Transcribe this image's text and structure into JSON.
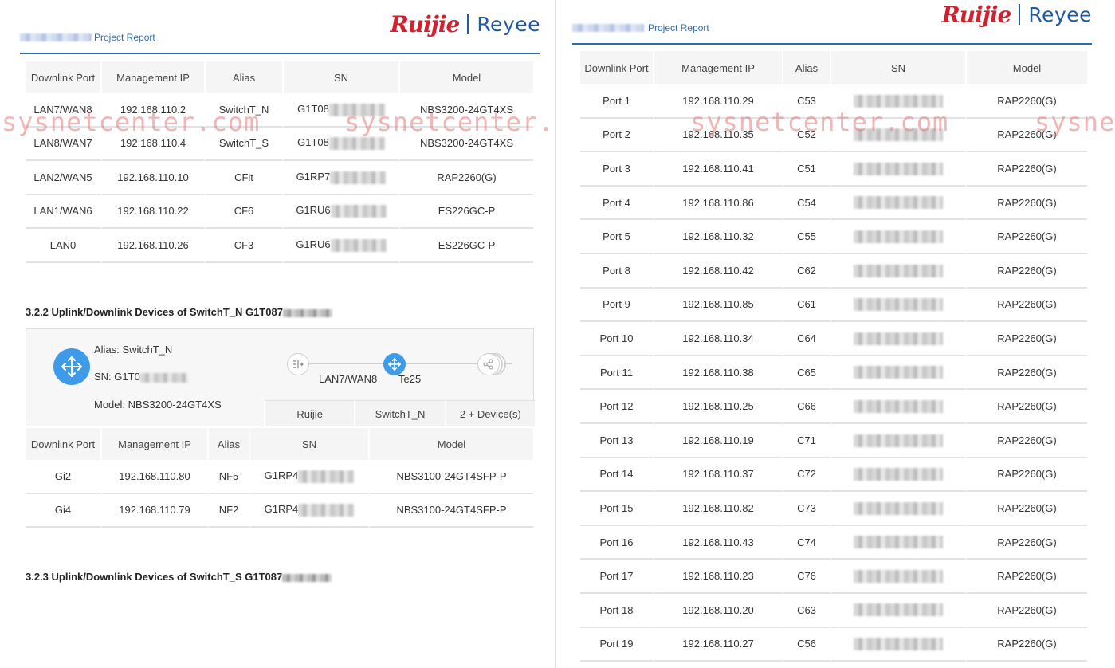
{
  "report_title": "Project Report",
  "logo": {
    "ruijie": "Ruijie",
    "reyee": "Reyee"
  },
  "watermark": "sysnetcenter.com",
  "watermark_partial": "sysne",
  "columns_main": [
    "Downlink Port",
    "Management IP",
    "Alias",
    "SN",
    "Model"
  ],
  "left_table": [
    {
      "port": "LAN7/WAN8",
      "ip": "192.168.110.2",
      "alias": "SwitchT_N",
      "sn": "G1T08",
      "model": "NBS3200-24GT4XS"
    },
    {
      "port": "LAN8/WAN7",
      "ip": "192.168.110.4",
      "alias": "SwitchT_S",
      "sn": "G1T08",
      "model": "NBS3200-24GT4XS"
    },
    {
      "port": "LAN2/WAN5",
      "ip": "192.168.110.10",
      "alias": "CFit",
      "sn": "G1RP7",
      "model": "RAP2260(G)"
    },
    {
      "port": "LAN1/WAN6",
      "ip": "192.168.110.22",
      "alias": "CF6",
      "sn": "G1RU6",
      "model": "ES226GC-P"
    },
    {
      "port": "LAN0",
      "ip": "192.168.110.26",
      "alias": "CF3",
      "sn": "G1RU6",
      "model": "ES226GC-P"
    }
  ],
  "section_322": {
    "heading": "3.2.2 Uplink/Downlink Devices of SwitchT_N G1T087",
    "alias_line": "Alias: SwitchT_N",
    "sn_line": "SN: G1T0",
    "model_line": "Model: NBS3200-24GT4XS",
    "uplink_port": "LAN7/WAN8",
    "downlink_port": "Te25",
    "tabs": [
      "Ruijie",
      "SwitchT_N",
      "2 + Device(s)"
    ]
  },
  "section_322_table": [
    {
      "port": "Gi2",
      "ip": "192.168.110.80",
      "alias": "NF5",
      "sn": "G1RP4",
      "model": "NBS3100-24GT4SFP-P"
    },
    {
      "port": "Gi4",
      "ip": "192.168.110.79",
      "alias": "NF2",
      "sn": "G1RP4",
      "model": "NBS3100-24GT4SFP-P"
    }
  ],
  "section_323": {
    "heading": "3.2.3 Uplink/Downlink Devices of SwitchT_S G1T087"
  },
  "right_table": [
    {
      "port": "Port 1",
      "ip": "192.168.110.29",
      "alias": "C53",
      "model": "RAP2260(G)"
    },
    {
      "port": "Port 2",
      "ip": "192.168.110.35",
      "alias": "C52",
      "model": "RAP2260(G)"
    },
    {
      "port": "Port 3",
      "ip": "192.168.110.41",
      "alias": "C51",
      "model": "RAP2260(G)"
    },
    {
      "port": "Port 4",
      "ip": "192.168.110.86",
      "alias": "C54",
      "model": "RAP2260(G)"
    },
    {
      "port": "Port 5",
      "ip": "192.168.110.32",
      "alias": "C55",
      "model": "RAP2260(G)"
    },
    {
      "port": "Port 8",
      "ip": "192.168.110.42",
      "alias": "C62",
      "model": "RAP2260(G)"
    },
    {
      "port": "Port 9",
      "ip": "192.168.110.85",
      "alias": "C61",
      "model": "RAP2260(G)"
    },
    {
      "port": "Port 10",
      "ip": "192.168.110.34",
      "alias": "C64",
      "model": "RAP2260(G)"
    },
    {
      "port": "Port 11",
      "ip": "192.168.110.38",
      "alias": "C65",
      "model": "RAP2260(G)"
    },
    {
      "port": "Port 12",
      "ip": "192.168.110.25",
      "alias": "C66",
      "model": "RAP2260(G)"
    },
    {
      "port": "Port 13",
      "ip": "192.168.110.19",
      "alias": "C71",
      "model": "RAP2260(G)"
    },
    {
      "port": "Port 14",
      "ip": "192.168.110.37",
      "alias": "C72",
      "model": "RAP2260(G)"
    },
    {
      "port": "Port 15",
      "ip": "192.168.110.82",
      "alias": "C73",
      "model": "RAP2260(G)"
    },
    {
      "port": "Port 16",
      "ip": "192.168.110.43",
      "alias": "C74",
      "model": "RAP2260(G)"
    },
    {
      "port": "Port 17",
      "ip": "192.168.110.23",
      "alias": "C76",
      "model": "RAP2260(G)"
    },
    {
      "port": "Port 18",
      "ip": "192.168.110.20",
      "alias": "C63",
      "model": "RAP2260(G)"
    },
    {
      "port": "Port 19",
      "ip": "192.168.110.27",
      "alias": "C56",
      "model": "RAP2260(G)"
    }
  ]
}
